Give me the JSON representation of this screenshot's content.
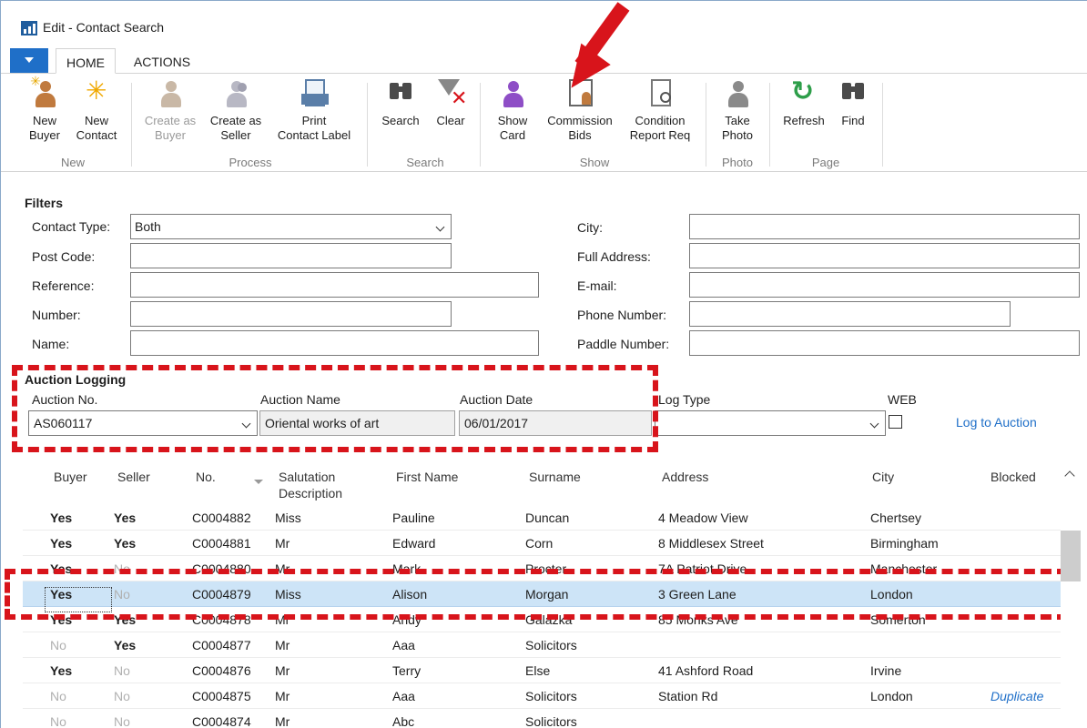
{
  "window": {
    "title": "Edit - Contact Search"
  },
  "ribbon_tabs": [
    "HOME",
    "ACTIONS"
  ],
  "ribbon": {
    "new": {
      "group": "New",
      "new_buyer": "New\nBuyer",
      "new_contact": "New\nContact"
    },
    "process": {
      "group": "Process",
      "create_buyer": "Create as\nBuyer",
      "create_seller": "Create as\nSeller",
      "print_label": "Print\nContact Label"
    },
    "search": {
      "group": "Search",
      "search": "Search",
      "clear": "Clear"
    },
    "show": {
      "group": "Show",
      "show_card": "Show\nCard",
      "commission_bids": "Commission\nBids",
      "condition_report": "Condition\nReport Req"
    },
    "photo": {
      "group": "Photo",
      "take_photo": "Take\nPhoto"
    },
    "page": {
      "group": "Page",
      "refresh": "Refresh",
      "find": "Find"
    }
  },
  "filters": {
    "title": "Filters",
    "contact_type_label": "Contact Type:",
    "contact_type_value": "Both",
    "post_code_label": "Post Code:",
    "reference_label": "Reference:",
    "number_label": "Number:",
    "name_label": "Name:",
    "city_label": "City:",
    "full_address_label": "Full Address:",
    "email_label": "E-mail:",
    "phone_label": "Phone Number:",
    "paddle_label": "Paddle Number:"
  },
  "auction": {
    "title": "Auction Logging",
    "no_label": "Auction No.",
    "no_value": "AS060117",
    "name_label": "Auction Name",
    "name_value": "Oriental works of art",
    "date_label": "Auction Date",
    "date_value": "06/01/2017",
    "log_type_label": "Log Type",
    "web_label": "WEB",
    "log_link": "Log to Auction"
  },
  "grid": {
    "headers": [
      "Buyer",
      "Seller",
      "No.",
      "Salutation\nDescription",
      "First Name",
      "Surname",
      "Address",
      "City",
      "Blocked"
    ],
    "rows": [
      {
        "buyer": "Yes",
        "seller": "Yes",
        "no": "C0004882",
        "sal": "Miss",
        "first": "Pauline",
        "surname": "Duncan",
        "address": "4 Meadow View",
        "city": "Chertsey",
        "blocked": ""
      },
      {
        "buyer": "Yes",
        "seller": "Yes",
        "no": "C0004881",
        "sal": "Mr",
        "first": "Edward",
        "surname": "Corn",
        "address": "8 Middlesex Street",
        "city": "Birmingham",
        "blocked": ""
      },
      {
        "buyer": "Yes",
        "seller": "No",
        "no": "C0004880",
        "sal": "Mr",
        "first": "Mark",
        "surname": "Procter",
        "address": "7A Patriot Drive",
        "city": "Manchester",
        "blocked": ""
      },
      {
        "buyer": "Yes",
        "seller": "No",
        "no": "C0004879",
        "sal": "Miss",
        "first": "Alison",
        "surname": "Morgan",
        "address": "3 Green Lane",
        "city": "London",
        "blocked": ""
      },
      {
        "buyer": "Yes",
        "seller": "Yes",
        "no": "C0004878",
        "sal": "Mr",
        "first": "Andy",
        "surname": "Galazka",
        "address": "85 Monks Ave",
        "city": "Somerton",
        "blocked": ""
      },
      {
        "buyer": "No",
        "seller": "Yes",
        "no": "C0004877",
        "sal": "Mr",
        "first": "Aaa",
        "surname": "Solicitors",
        "address": "",
        "city": "",
        "blocked": ""
      },
      {
        "buyer": "Yes",
        "seller": "No",
        "no": "C0004876",
        "sal": "Mr",
        "first": "Terry",
        "surname": "Else",
        "address": "41 Ashford Road",
        "city": "Irvine",
        "blocked": ""
      },
      {
        "buyer": "No",
        "seller": "No",
        "no": "C0004875",
        "sal": "Mr",
        "first": "Aaa",
        "surname": "Solicitors",
        "address": "Station Rd",
        "city": "London",
        "blocked": "Duplicate"
      },
      {
        "buyer": "No",
        "seller": "No",
        "no": "C0004874",
        "sal": "Mr",
        "first": "Abc",
        "surname": "Solicitors",
        "address": "",
        "city": "",
        "blocked": ""
      }
    ]
  },
  "colors": {
    "accent": "#1f6fc8",
    "annotation": "#d8141b",
    "selected_row": "#cde4f7"
  }
}
